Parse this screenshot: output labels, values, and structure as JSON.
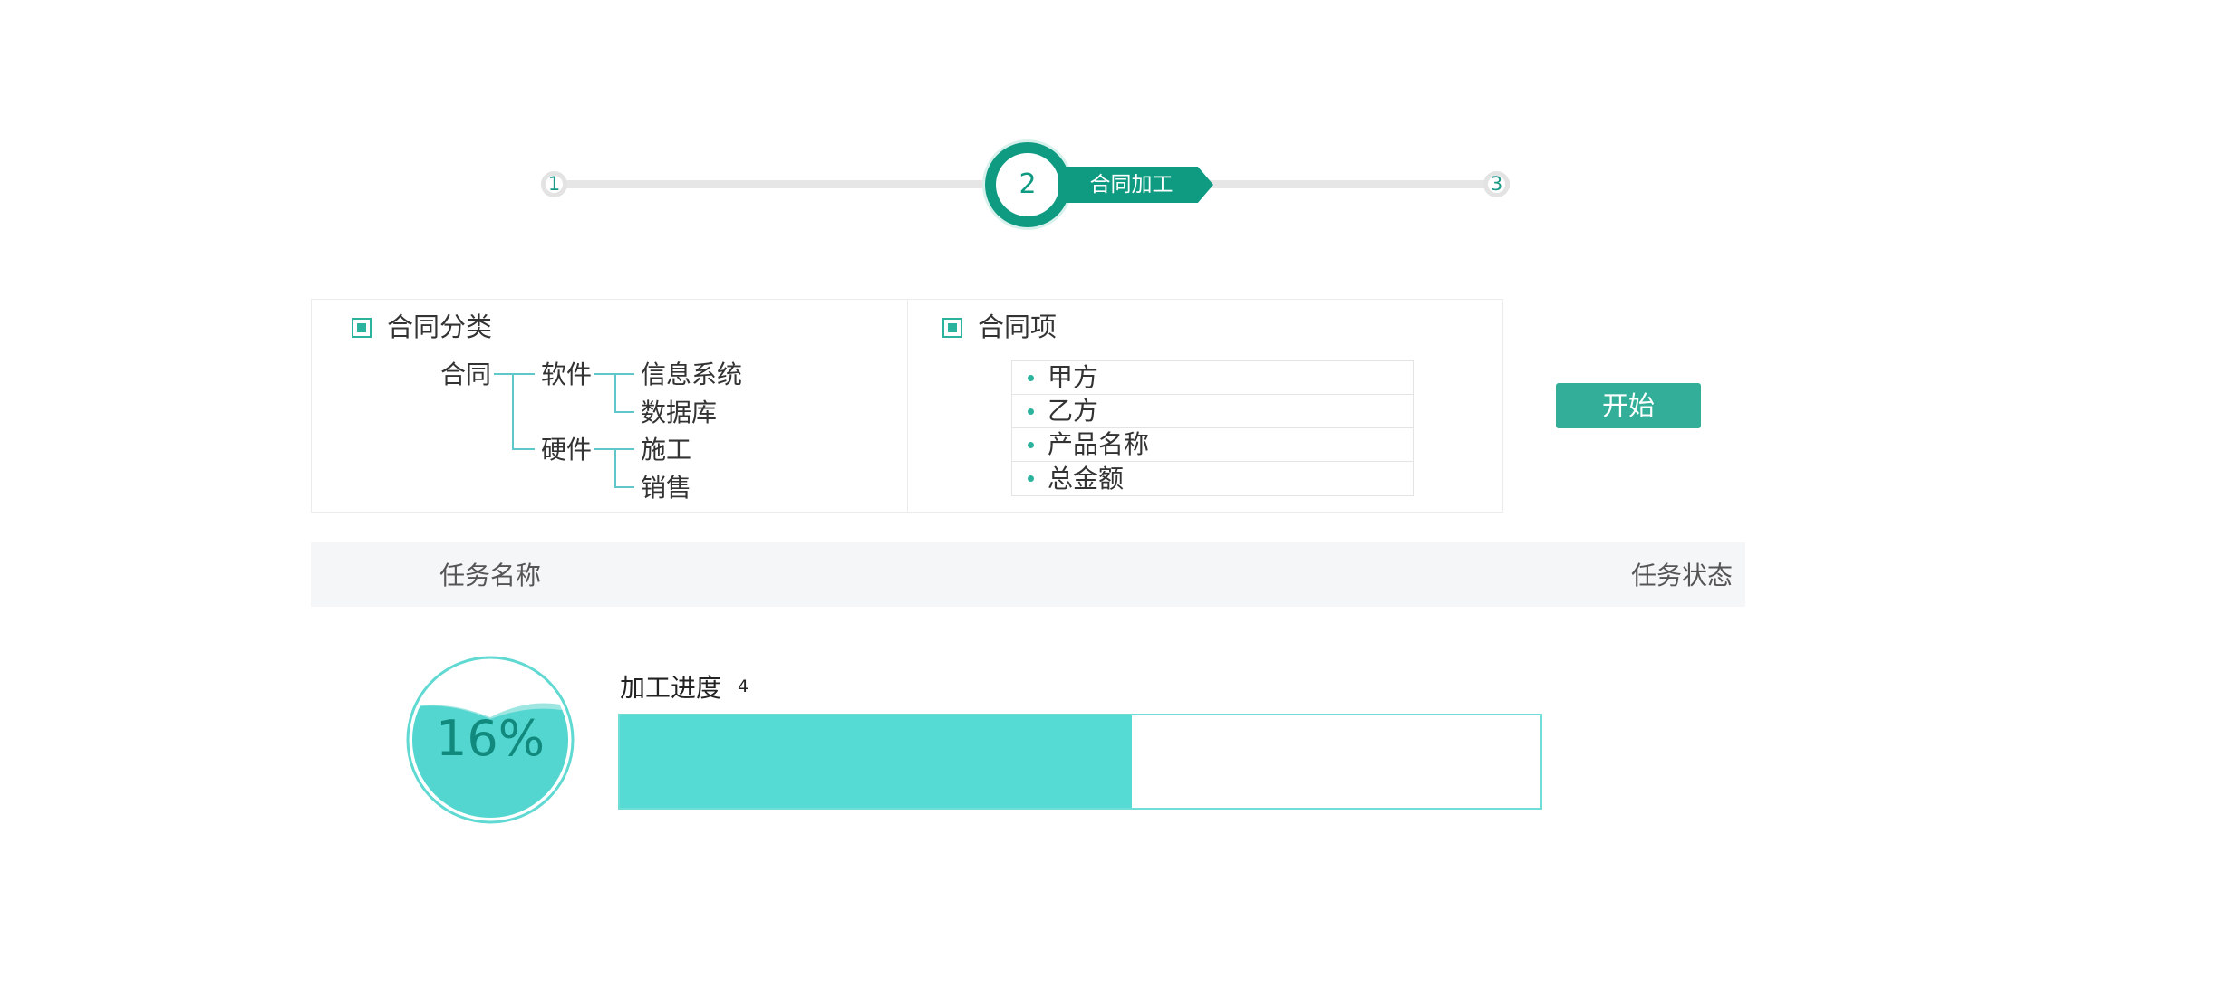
{
  "stepper": {
    "steps": [
      {
        "number": "1"
      },
      {
        "number": "2",
        "label": "合同加工",
        "active": true
      },
      {
        "number": "3"
      }
    ],
    "accent_color": "#0f9a82"
  },
  "config": {
    "category_panel": {
      "title": "合同分类",
      "tree": {
        "root": "合同",
        "branches": [
          {
            "label": "软件",
            "children": [
              "信息系统",
              "数据库"
            ]
          },
          {
            "label": "硬件",
            "children": [
              "施工",
              "销售"
            ]
          }
        ]
      }
    },
    "item_panel": {
      "title": "合同项",
      "items": [
        "甲方",
        "乙方",
        "产品名称",
        "总金额"
      ]
    },
    "start_button": "开始"
  },
  "task_table": {
    "columns": [
      "任务名称",
      "任务状态"
    ]
  },
  "progress": {
    "percent_text": "16%",
    "percent_value": 16,
    "title": "加工进度",
    "count": "4",
    "bar_fill_fraction": 0.556,
    "color": "#56dbd4"
  },
  "icons": {
    "checkbox": "checkbox-partial-icon",
    "bullet": "dot-bullet-icon"
  }
}
